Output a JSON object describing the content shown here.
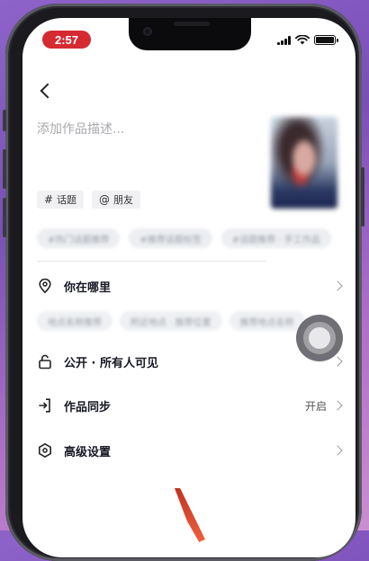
{
  "status_bar": {
    "time": "2:57"
  },
  "header": {
    "back_icon": "chevron-left-icon"
  },
  "description": {
    "placeholder": "添加作品描述..."
  },
  "chips": [
    {
      "symbol": "#",
      "label": "话题"
    },
    {
      "symbol": "@",
      "label": "朋友"
    }
  ],
  "suggestions": [
    "#热门话题推荐",
    "#推荐话题标签",
    "#话题推荐 · 手工作品"
  ],
  "location": {
    "label": "你在哪里",
    "nearby": [
      "地点名称推荐",
      "附近地点 · 推荐位置",
      "推荐地点名称"
    ]
  },
  "privacy": {
    "label": "公开 · 所有人可见"
  },
  "sync": {
    "label": "作品同步",
    "value": "开启"
  },
  "advanced": {
    "label": "高级设置"
  },
  "colors": {
    "status_red": "#d62a31",
    "text_primary": "#161823",
    "placeholder": "#a9a9ae"
  }
}
